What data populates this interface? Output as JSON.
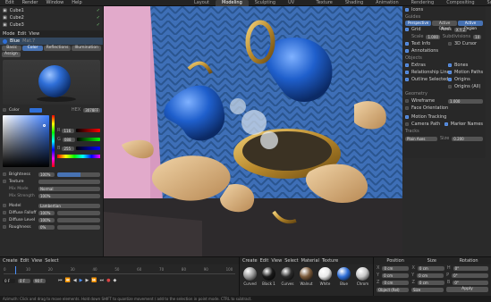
{
  "menu": [
    "Edit",
    "Render",
    "Window",
    "Help"
  ],
  "workspaces": [
    "Layout",
    "Modeling",
    "Sculpting",
    "UV Editing",
    "Texture Paint",
    "Shading",
    "Animation",
    "Rendering",
    "Compositing",
    "Scripting"
  ],
  "active_workspace": "Modeling",
  "outliner": {
    "items": [
      "Cube1",
      "Cube2",
      "Cube3"
    ]
  },
  "left_header": {
    "mode": "Mode",
    "edit": "Edit",
    "view": "View"
  },
  "material_tabs": [
    "Basic",
    "Color",
    "Reflections",
    "Illumination"
  ],
  "assign_label": "Assign",
  "material_name": "Blue",
  "material_sub": "Mat.7",
  "color": {
    "label": "Color",
    "hex_label": "HEX",
    "hex_value": "3078FF",
    "rgb": [
      {
        "ch": "R",
        "val": "116"
      },
      {
        "ch": "G",
        "val": "088"
      },
      {
        "ch": "B",
        "val": "255"
      }
    ]
  },
  "brightness": {
    "label": "Brightness",
    "value": "100%",
    "fill": 0.55
  },
  "texture": {
    "label": "Texture"
  },
  "mix_mode": {
    "label": "Mix Mode",
    "value": "Normal"
  },
  "mix_strength": {
    "label": "Mix Strength",
    "value": "100%"
  },
  "model": {
    "label": "Model",
    "value": "Lambertian"
  },
  "diffuse_falloff": {
    "label": "Diffuse Falloff",
    "value": "100%"
  },
  "diffuse_level": {
    "label": "Diffuse Level",
    "value": "100%"
  },
  "roughness": {
    "label": "Roughness",
    "value": "0%"
  },
  "overlays": {
    "section1": "Guides",
    "icons_label": "Icons",
    "tabs": [
      "Perspective",
      "Active Object",
      "Active Region"
    ],
    "grid": "Grid",
    "axes_label": "Axes",
    "axes_val": "X Y Z",
    "scale_label": "Scale",
    "scale_val": "1.000",
    "subdiv_label": "Subdivisions",
    "subdiv_val": "10",
    "text_info": "Text Info",
    "cursor_3d": "3D Cursor",
    "annotations": "Annotations",
    "objects": "Objects",
    "extras": "Extras",
    "bones": "Bones",
    "rel_lines": "Relationship Lines",
    "motion_paths": "Motion Paths",
    "outline_sel": "Outline Selected",
    "origins": "Origins",
    "origins_all": "Origins (All)",
    "geometry": "Geometry",
    "wireframe": "Wireframe",
    "wire_val": "1.000",
    "face_orient": "Face Orientation",
    "motion_tracking": "Motion Tracking",
    "camera_path": "Camera Path",
    "marker_names": "Marker Names",
    "tracks": "Tracks",
    "plain_axes": "Plain Axes",
    "size_label": "Size",
    "size_val": "0.200"
  },
  "timeline": {
    "menus": [
      "Create",
      "Edit",
      "View",
      "Select"
    ],
    "ticks": [
      "0",
      "10",
      "20",
      "30",
      "40",
      "50",
      "60",
      "70",
      "80",
      "90",
      "100"
    ],
    "current_frame": "0 F",
    "start": "0 F",
    "end": "90 F",
    "playhead_frac": 0.05
  },
  "material_browser": {
    "menus": [
      "Create",
      "Edit",
      "View",
      "Select",
      "Material",
      "Texture"
    ],
    "materials": [
      {
        "name": "Curved",
        "color": "#9a9a9a"
      },
      {
        "name": "Black 1",
        "color": "#1a1a1a"
      },
      {
        "name": "Curves",
        "color": "#2c2c2c"
      },
      {
        "name": "Walnut",
        "color": "#7a5a3a"
      },
      {
        "name": "White",
        "color": "#e8e8e8"
      },
      {
        "name": "Blue",
        "color": "#2f6fd8"
      },
      {
        "name": "Chrom",
        "color": "#c7c7c7"
      }
    ]
  },
  "transform": {
    "headers": [
      "Position",
      "Size",
      "Rotation"
    ],
    "rows": [
      {
        "axis": "X",
        "pos": "0 cm",
        "size": "0 cm",
        "rot": "0°"
      },
      {
        "axis": "Y",
        "pos": "0 cm",
        "size": "0 cm",
        "rot": "0°"
      },
      {
        "axis": "Z",
        "pos": "0 cm",
        "size": "0 cm",
        "rot": "0°"
      }
    ],
    "mode": "Object (Rel)",
    "size_mode": "Size",
    "apply": "Apply"
  },
  "status": "Azimuth: Click and drag to move elements. Hold down SHIFT to quantize movement / add to the selection in point mode. CTRL to subtract."
}
